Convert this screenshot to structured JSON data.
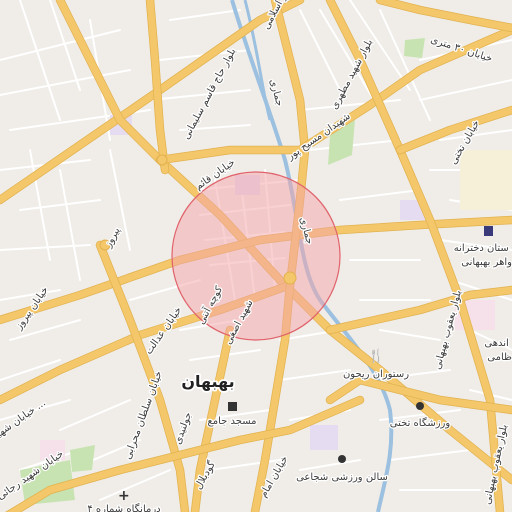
{
  "map": {
    "colors": {
      "land": "#f0ede8",
      "major_road": "#f3c76a",
      "river": "#9cc0e0",
      "park": "#c8e3b2",
      "selection_fill": "#f4a3a8",
      "selection_stroke": "#e0626b",
      "purple_area": "#e6dcf2",
      "pink_area": "#f6e0ea"
    },
    "street_labels": {
      "s1": "بلوار شهید مطهری",
      "s2": "بلوار حاج قاسم سلیمانی",
      "s3": "شهیدان مسیح پور",
      "s4": "جماری",
      "s5": "جماری",
      "s6": "خیابان قائم",
      "s7": "پیروز",
      "s8": "خیابان پیروز",
      "s9": "کوچه آتنی",
      "s10": "شهید اصغی",
      "s11": "خیابان عدالت",
      "s12": "خیابان سلطان محرابی",
      "s13": "جولنیدی",
      "s14": "خیابان امام",
      "s15": "گودبلال",
      "s16": "خیابان ۳۰ متری",
      "s17": "خیابان تختی",
      "s18": "بلوار یعقوب بهبهانی",
      "s19": "بلوار یعقوب بهبهانی",
      "s20": "خیابان شهید رجائی",
      "s21": "خیابان شهید ...",
      "s22": "بلوار اسلامی"
    },
    "city_label": "بهبهان",
    "pois": {
      "hospital": "ستان دخترانه\nواهر بهبهانی",
      "restaurant": "رستوران ریحون",
      "mosque": "مسجد جامع",
      "stadium": "ورزشگاه تختی",
      "gym": "سالن ورزشی شجاعی",
      "clinic": "درمانگاه شماره ۴",
      "school": "اندهی\nظامی"
    }
  }
}
